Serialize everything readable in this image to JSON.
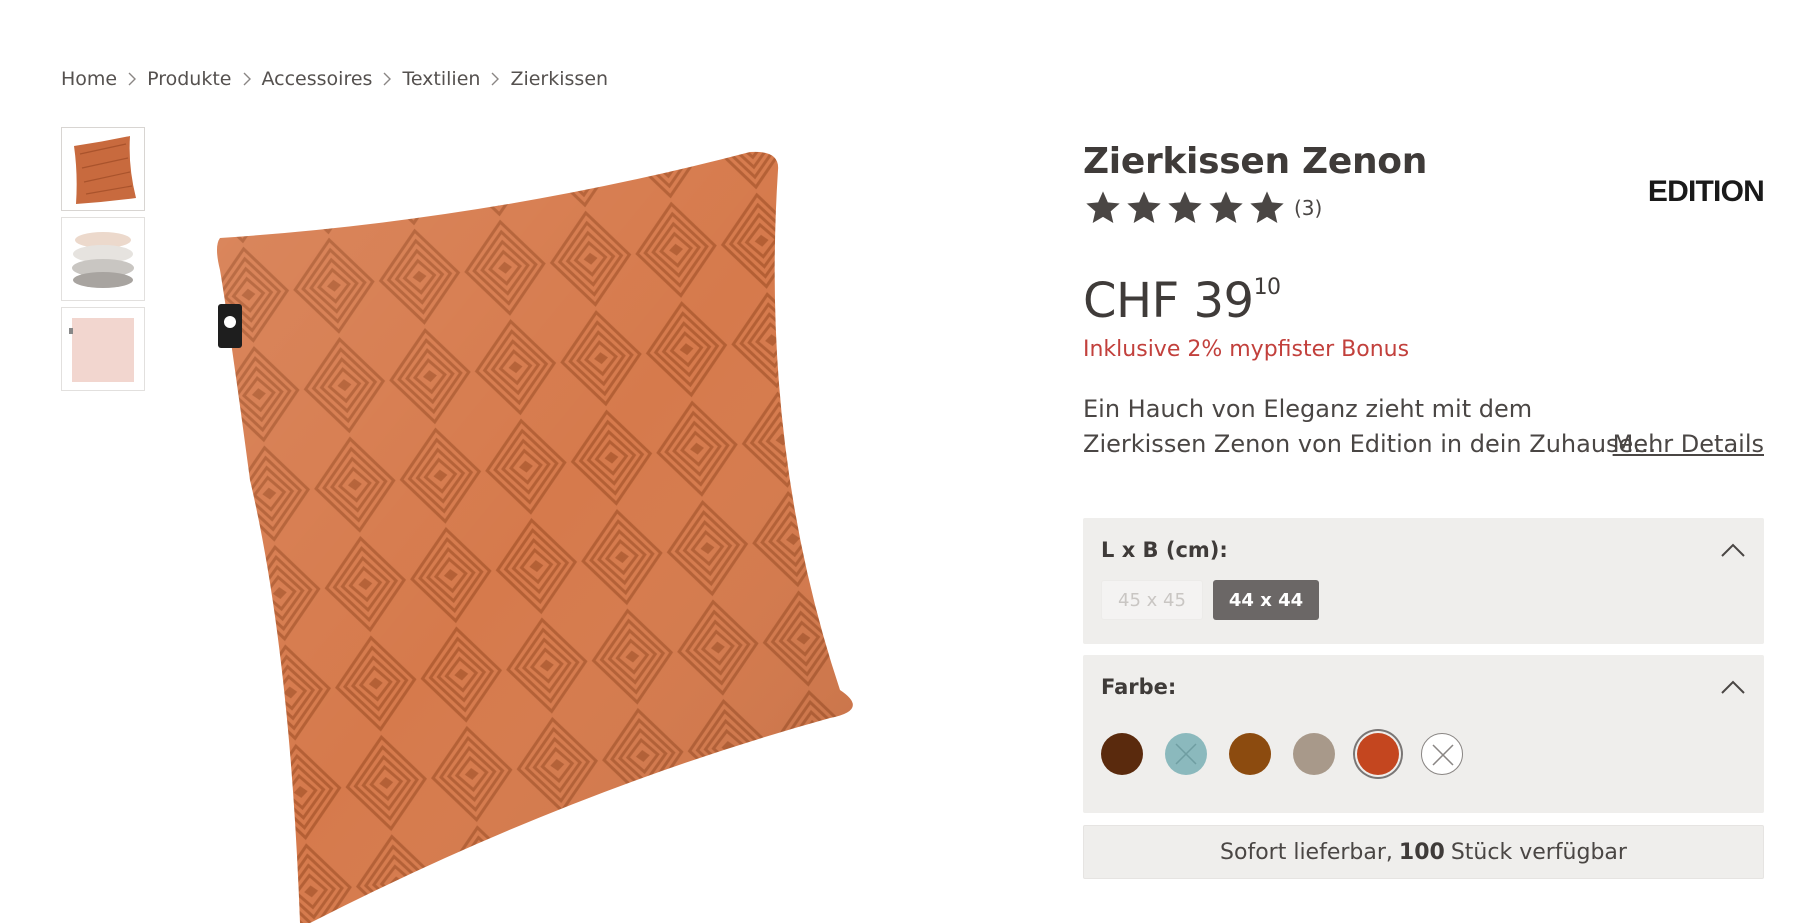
{
  "breadcrumb": [
    "Home",
    "Produkte",
    "Accessoires",
    "Textilien",
    "Zierkissen"
  ],
  "product": {
    "title": "Zierkissen Zenon",
    "brand": "EDITION",
    "rating_stars": 5,
    "review_count": "(3)",
    "price_main": "CHF 39",
    "price_cents": "10",
    "bonus": "Inklusive 2% mypfister Bonus",
    "description_line1": "Ein Hauch von Eleganz zieht mit dem",
    "description_line2": "Zierkissen Zenon von Edition in dein Zuhause...",
    "more_details": "Mehr Details"
  },
  "size_option": {
    "label": "L x B (cm):",
    "values": [
      {
        "label": "45 x 45",
        "state": "disabled"
      },
      {
        "label": "44 x 44",
        "state": "selected"
      }
    ]
  },
  "color_option": {
    "label": "Farbe:",
    "swatches": [
      {
        "color": "#5a2a0d",
        "state": "available"
      },
      {
        "color": "#8bb9bd",
        "state": "unavailable"
      },
      {
        "color": "#8c4b0f",
        "state": "available"
      },
      {
        "color": "#a8998a",
        "state": "available"
      },
      {
        "color": "#c4461f",
        "state": "selected"
      },
      {
        "color": "#ffffff",
        "state": "unavailable"
      }
    ]
  },
  "stock": {
    "prefix": "Sofort lieferbar,",
    "count": "100",
    "suffix": "Stück verfügbar"
  },
  "colors": {
    "bonus_red": "#c2403c",
    "pillow": "#d27a4e"
  }
}
